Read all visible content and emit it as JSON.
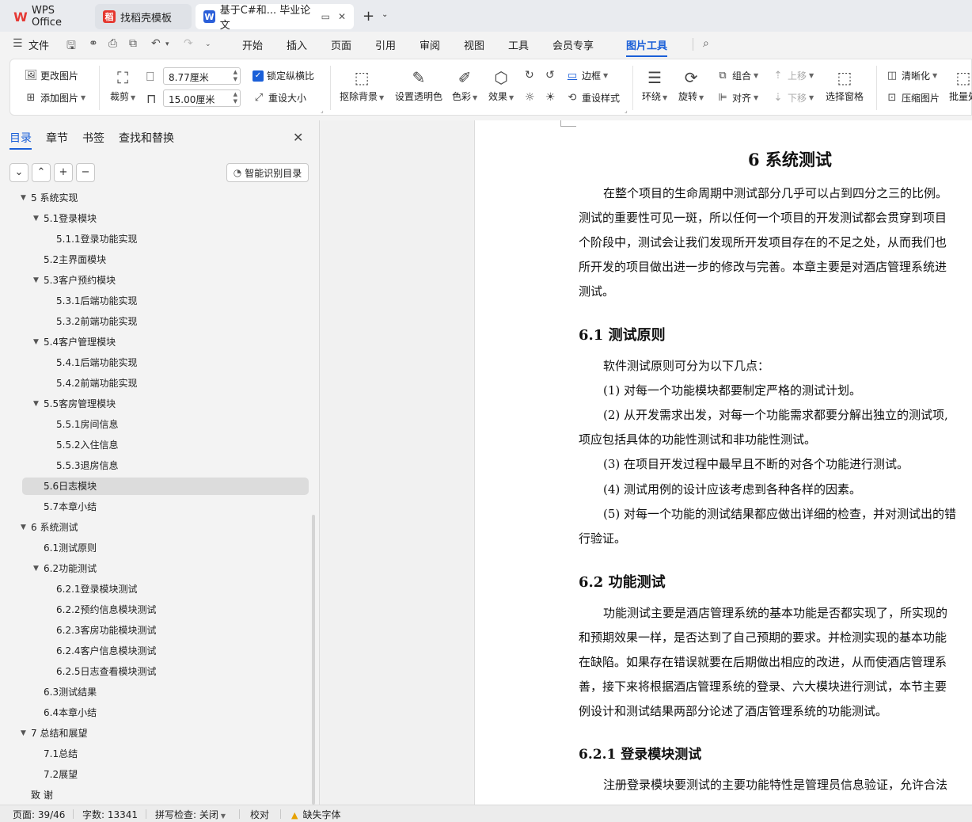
{
  "tabs": {
    "wps": "WPS Office",
    "template": "找稻壳模板",
    "doc": "基于C#和... 毕业论文",
    "doc_icon_label": "W",
    "template_icon_label": "稻",
    "new_tab": "+",
    "new_tab_menu": "⌄"
  },
  "menu": {
    "file": "文件",
    "items": [
      "开始",
      "插入",
      "页面",
      "引用",
      "审阅",
      "视图",
      "工具",
      "会员专享",
      "图片工具"
    ],
    "active": "图片工具"
  },
  "ribbon": {
    "change_image": "更改图片",
    "add_image": "添加图片",
    "crop": "裁剪",
    "width_value": "8.77厘米",
    "height_value": "15.00厘米",
    "lock_aspect": "锁定纵横比",
    "reset_size": "重设大小",
    "remove_bg": "抠除背景",
    "set_transparent": "设置透明色",
    "color": "色彩",
    "effects": "效果",
    "border": "边框",
    "reset_style": "重设样式",
    "wrap": "环绕",
    "rotate": "旋转",
    "group": "组合",
    "align": "对齐",
    "move_up": "上移",
    "move_down": "下移",
    "selection_pane": "选择窗格",
    "sharpen": "清晰化",
    "compress": "压缩图片",
    "batch": "批量处"
  },
  "nav": {
    "tabs": [
      "目录",
      "章节",
      "书签",
      "查找和替换"
    ],
    "active_tab": "目录",
    "smart_toc": "智能识别目录",
    "toc": [
      {
        "text": "5   系统实现",
        "level": 1,
        "expanded": true
      },
      {
        "text": "5.1登录模块",
        "level": 2,
        "expanded": true
      },
      {
        "text": "5.1.1登录功能实现",
        "level": 3
      },
      {
        "text": "5.2主界面模块",
        "level": 2
      },
      {
        "text": "5.3客户预约模块",
        "level": 2,
        "expanded": true
      },
      {
        "text": "5.3.1后端功能实现",
        "level": 3
      },
      {
        "text": "5.3.2前端功能实现",
        "level": 3
      },
      {
        "text": "5.4客户管理模块",
        "level": 2,
        "expanded": true
      },
      {
        "text": "5.4.1后端功能实现",
        "level": 3
      },
      {
        "text": "5.4.2前端功能实现",
        "level": 3
      },
      {
        "text": "5.5客房管理模块",
        "level": 2,
        "expanded": true
      },
      {
        "text": "5.5.1房间信息",
        "level": 3
      },
      {
        "text": "5.5.2入住信息",
        "level": 3
      },
      {
        "text": "5.5.3退房信息",
        "level": 3
      },
      {
        "text": "5.6日志模块",
        "level": 2,
        "selected": true
      },
      {
        "text": "5.7本章小结",
        "level": 2
      },
      {
        "text": "6   系统测试",
        "level": 1,
        "expanded": true
      },
      {
        "text": "6.1测试原则",
        "level": 2
      },
      {
        "text": "6.2功能测试",
        "level": 2,
        "expanded": true
      },
      {
        "text": "6.2.1登录模块测试",
        "level": 3
      },
      {
        "text": "6.2.2预约信息模块测试",
        "level": 3
      },
      {
        "text": "6.2.3客房功能模块测试",
        "level": 3
      },
      {
        "text": "6.2.4客户信息模块测试",
        "level": 3
      },
      {
        "text": "6.2.5日志查看模块测试",
        "level": 3
      },
      {
        "text": "6.3测试结果",
        "level": 2
      },
      {
        "text": "6.4本章小结",
        "level": 2
      },
      {
        "text": "7   总结和展望",
        "level": 1,
        "expanded": true
      },
      {
        "text": "7.1总结",
        "level": 2
      },
      {
        "text": "7.2展望",
        "level": 2
      },
      {
        "text": "致   谢",
        "level": 1
      }
    ]
  },
  "document": {
    "h1": "6    系统测试",
    "p1": [
      "在整个项目的生命周期中测试部分几乎可以占到四分之三的比例。",
      "测试的重要性可见一斑，所以任何一个项目的开发测试都会贯穿到项目",
      "个阶段中，测试会让我们发现所开发项目存在的不足之处，从而我们也",
      "所开发的项目做出进一步的修改与完善。本章主要是对酒店管理系统进",
      "测试。"
    ],
    "h2a": "6.1    测试原则",
    "p2_intro": "软件测试原则可分为以下几点：",
    "principles": [
      "(1)  对每一个功能模块都要制定严格的测试计划。",
      "(2)  从开发需求出发，对每一个功能需求都要分解出独立的测试项,",
      "项应包括具体的功能性测试和非功能性测试。",
      "(3)  在项目开发过程中最早且不断的对各个功能进行测试。",
      "(4)  测试用例的设计应该考虑到各种各样的因素。",
      "(5)  对每一个功能的测试结果都应做出详细的检查，并对测试出的错",
      "行验证。"
    ],
    "h2b": "6.2    功能测试",
    "p3": [
      "功能测试主要是酒店管理系统的基本功能是否都实现了，所实现的",
      "和预期效果一样，是否达到了自己预期的要求。并检测实现的基本功能",
      "在缺陷。如果存在错误就要在后期做出相应的改进，从而使酒店管理系",
      "善，接下来将根据酒店管理系统的登录、六大模块进行测试，本节主要",
      "例设计和测试结果两部分论述了酒店管理系统的功能测试。"
    ],
    "h3": "6.2.1    登录模块测试",
    "p4": "注册登录模块要测试的主要功能特性是管理员信息验证，允许合法"
  },
  "status": {
    "page": "页面: 39/46",
    "words": "字数: 13341",
    "spell": "拼写检查: 关闭",
    "proof": "校对",
    "missing_font": "缺失字体"
  }
}
